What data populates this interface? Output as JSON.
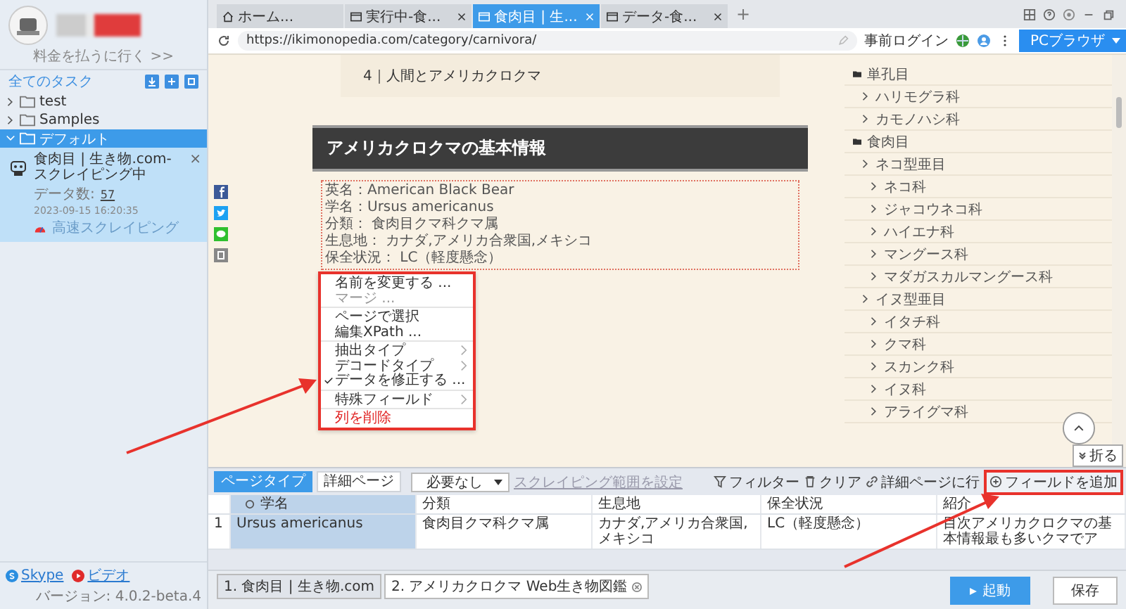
{
  "sidebar": {
    "account_link": "料金を払うに行く >>",
    "section_title": "全てのタスク",
    "folders": [
      {
        "name": "test",
        "expanded": false,
        "selected": false
      },
      {
        "name": "Samples",
        "expanded": false,
        "selected": false
      },
      {
        "name": "デフォルト",
        "expanded": true,
        "selected": true,
        "tasks": [
          {
            "title": "食肉目 | 生き物.com-スクレイピング中",
            "data_label": "データ数:",
            "data_count": "57",
            "timestamp": "2023-09-15 16:20:35",
            "mode": "高速スクレイピング",
            "close": "×"
          }
        ]
      }
    ],
    "footer_links": [
      {
        "label": "Skype",
        "kind": "skype"
      },
      {
        "label": "ビデオ",
        "kind": "video"
      }
    ],
    "version": "バージョン: 4.0.2-beta.4"
  },
  "browser": {
    "tabs": [
      {
        "label": "ホーム...",
        "kind": "home",
        "selected": false
      },
      {
        "label": "実行中-食...",
        "kind": "page",
        "selected": false
      },
      {
        "label": "食肉目 | 生...",
        "kind": "page",
        "selected": true
      },
      {
        "label": "データ-食...",
        "kind": "page",
        "selected": false
      }
    ],
    "new_tab": "+",
    "url": "https://ikimonopedia.com/category/carnivora/",
    "login_button": "事前ログイン",
    "browser_mode": "PCブラウザ"
  },
  "page": {
    "toc_item": "4｜人間とアメリカクロクマ",
    "heading": "アメリカクロクマの基本情報",
    "info_lines": [
      "英名：American Black Bear",
      "学名：Ursus americanus",
      "分類： 食肉目クマ科クマ属",
      "生息地： カナダ,アメリカ合衆国,メキシコ",
      "保全状況： LC（軽度懸念）"
    ],
    "category_tree": [
      {
        "label": "単孔目",
        "kind": "folder",
        "children": [
          {
            "label": "ハリモグラ科",
            "kind": "link"
          },
          {
            "label": "カモノハシ科",
            "kind": "link"
          }
        ]
      },
      {
        "label": "食肉目",
        "kind": "folder",
        "children": [
          {
            "label": "ネコ型亜目",
            "kind": "link",
            "children": [
              {
                "label": "ネコ科",
                "kind": "link"
              },
              {
                "label": "ジャコウネコ科",
                "kind": "link"
              },
              {
                "label": "ハイエナ科",
                "kind": "link"
              },
              {
                "label": "マングース科",
                "kind": "link"
              },
              {
                "label": "マダガスカルマングース科",
                "kind": "link"
              }
            ]
          },
          {
            "label": "イヌ型亜目",
            "kind": "link",
            "children": [
              {
                "label": "イタチ科",
                "kind": "link"
              },
              {
                "label": "クマ科",
                "kind": "link"
              },
              {
                "label": "スカンク科",
                "kind": "link"
              },
              {
                "label": "イヌ科",
                "kind": "link"
              },
              {
                "label": "アライグマ科",
                "kind": "link"
              }
            ]
          }
        ]
      }
    ],
    "collapse_button": "折る"
  },
  "context_menu": {
    "groups": [
      [
        {
          "label": "名前を変更する ...",
          "disabled": false,
          "checked": false,
          "submenu": false,
          "danger": false
        },
        {
          "label": "マージ ...",
          "disabled": true,
          "checked": false,
          "submenu": false,
          "danger": false
        }
      ],
      [
        {
          "label": "ページで選択",
          "disabled": false,
          "checked": false,
          "submenu": false,
          "danger": false
        },
        {
          "label": "編集XPath ...",
          "disabled": false,
          "checked": false,
          "submenu": false,
          "danger": false
        }
      ],
      [
        {
          "label": "抽出タイプ",
          "disabled": false,
          "checked": false,
          "submenu": true,
          "danger": false
        },
        {
          "label": "デコードタイプ",
          "disabled": false,
          "checked": false,
          "submenu": true,
          "danger": false
        },
        {
          "label": "データを修正する ...",
          "disabled": false,
          "checked": true,
          "submenu": false,
          "danger": false
        }
      ],
      [
        {
          "label": "特殊フィールド",
          "disabled": false,
          "checked": false,
          "submenu": true,
          "danger": false
        }
      ],
      [
        {
          "label": "列を削除",
          "disabled": false,
          "checked": false,
          "submenu": false,
          "danger": true
        }
      ]
    ]
  },
  "field_panel": {
    "page_tabs": [
      {
        "label": "ページタイプ",
        "selected": true
      },
      {
        "label": "詳細ページ",
        "selected": false
      }
    ],
    "select": "必要なし",
    "range_link": "スクレイピング範囲を設定",
    "tools": [
      {
        "label": "フィルター",
        "kind": "filter"
      },
      {
        "label": "クリア",
        "kind": "trash"
      },
      {
        "label": "詳細ページに行",
        "kind": "link"
      }
    ],
    "add_field": "フィールドを追加",
    "columns": [
      {
        "label": "学名",
        "selected": true
      },
      {
        "label": "分類",
        "selected": false
      },
      {
        "label": "生息地",
        "selected": false
      },
      {
        "label": "保全状況",
        "selected": false
      },
      {
        "label": "紹介",
        "selected": false
      }
    ],
    "rows": [
      {
        "index": "1",
        "cells": [
          "Ursus americanus",
          "食肉目クマ科クマ属",
          "カナダ,アメリカ合衆国,メキシコ",
          "LC（軽度懸念）",
          "目次アメリカクロクマの基本情報最も多いクマでア"
        ]
      }
    ]
  },
  "bottom": {
    "page_tabs": [
      {
        "label": "1. 食肉目 | 生き物.com",
        "selected": false
      },
      {
        "label": "2. アメリカクロクマ Web生き物図鑑",
        "selected": true
      }
    ],
    "start_button": "起動",
    "save_button": "保存"
  }
}
